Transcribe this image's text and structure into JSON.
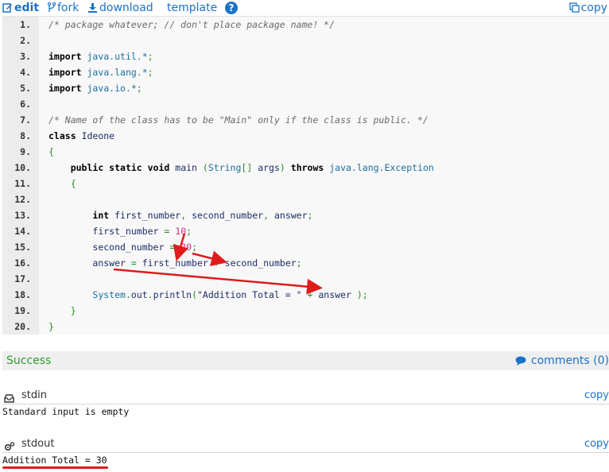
{
  "toolbar": {
    "edit_label": "edit",
    "fork_label": "fork",
    "download_label": "download",
    "template_label": "template",
    "help_icon": "?",
    "copy_label": "copy"
  },
  "code_lines": [
    {
      "n": "1.",
      "tokens": [
        [
          "c-comment",
          "/* package whatever; // don't place package name! */"
        ]
      ]
    },
    {
      "n": "2.",
      "tokens": []
    },
    {
      "n": "3.",
      "tokens": [
        [
          "c-kw",
          "import"
        ],
        [
          "",
          " "
        ],
        [
          "c-pkg",
          "java.util.*"
        ],
        [
          "c-punc",
          ";"
        ]
      ]
    },
    {
      "n": "4.",
      "tokens": [
        [
          "c-kw",
          "import"
        ],
        [
          "",
          " "
        ],
        [
          "c-pkg",
          "java.lang.*"
        ],
        [
          "c-punc",
          ";"
        ]
      ]
    },
    {
      "n": "5.",
      "tokens": [
        [
          "c-kw",
          "import"
        ],
        [
          "",
          " "
        ],
        [
          "c-pkg",
          "java.io.*"
        ],
        [
          "c-punc",
          ";"
        ]
      ]
    },
    {
      "n": "6.",
      "tokens": []
    },
    {
      "n": "7.",
      "tokens": [
        [
          "c-comment",
          "/* Name of the class has to be \"Main\" only if the class is public. */"
        ]
      ]
    },
    {
      "n": "8.",
      "tokens": [
        [
          "c-kw",
          "class"
        ],
        [
          "",
          " "
        ],
        [
          "c-id",
          "Ideone"
        ]
      ]
    },
    {
      "n": "9.",
      "tokens": [
        [
          "c-punc",
          "{"
        ]
      ]
    },
    {
      "n": "10.",
      "tokens": [
        [
          "",
          "    "
        ],
        [
          "c-kw",
          "public static void"
        ],
        [
          "",
          " "
        ],
        [
          "c-id",
          "main"
        ],
        [
          "",
          " "
        ],
        [
          "c-punc",
          "("
        ],
        [
          "c-type",
          "String"
        ],
        [
          "c-punc",
          "[]"
        ],
        [
          "",
          " "
        ],
        [
          "c-id",
          "args"
        ],
        [
          "c-punc",
          ")"
        ],
        [
          "",
          " "
        ],
        [
          "c-kw",
          "throws"
        ],
        [
          "",
          " "
        ],
        [
          "c-pkg",
          "java.lang."
        ],
        [
          "c-type",
          "Exception"
        ]
      ]
    },
    {
      "n": "11.",
      "tokens": [
        [
          "",
          "    "
        ],
        [
          "c-punc",
          "{"
        ]
      ]
    },
    {
      "n": "12.",
      "tokens": []
    },
    {
      "n": "13.",
      "tokens": [
        [
          "",
          "        "
        ],
        [
          "c-kw",
          "int"
        ],
        [
          "",
          " "
        ],
        [
          "c-id",
          "first_number"
        ],
        [
          "c-punc",
          ","
        ],
        [
          "",
          " "
        ],
        [
          "c-id",
          "second_number"
        ],
        [
          "c-punc",
          ","
        ],
        [
          "",
          " "
        ],
        [
          "c-id",
          "answer"
        ],
        [
          "c-punc",
          ";"
        ]
      ]
    },
    {
      "n": "14.",
      "tokens": [
        [
          "",
          "        "
        ],
        [
          "c-id",
          "first_number"
        ],
        [
          "",
          " "
        ],
        [
          "c-punc",
          "="
        ],
        [
          "",
          " "
        ],
        [
          "c-num",
          "10"
        ],
        [
          "c-punc",
          ";"
        ]
      ]
    },
    {
      "n": "15.",
      "tokens": [
        [
          "",
          "        "
        ],
        [
          "c-id",
          "second_number"
        ],
        [
          "",
          " "
        ],
        [
          "c-punc",
          "="
        ],
        [
          "",
          " "
        ],
        [
          "c-num",
          "20"
        ],
        [
          "c-punc",
          ";"
        ]
      ]
    },
    {
      "n": "16.",
      "tokens": [
        [
          "",
          "        "
        ],
        [
          "c-id",
          "answer"
        ],
        [
          "",
          " "
        ],
        [
          "c-punc",
          "="
        ],
        [
          "",
          " "
        ],
        [
          "c-id",
          "first_number"
        ],
        [
          "",
          " "
        ],
        [
          "c-punc",
          "+"
        ],
        [
          "",
          " "
        ],
        [
          "c-id",
          "second_number"
        ],
        [
          "c-punc",
          ";"
        ]
      ]
    },
    {
      "n": "17.",
      "tokens": []
    },
    {
      "n": "18.",
      "tokens": [
        [
          "",
          "        "
        ],
        [
          "c-type",
          "System"
        ],
        [
          "c-punc",
          "."
        ],
        [
          "c-id",
          "out"
        ],
        [
          "c-punc",
          "."
        ],
        [
          "c-id",
          "println"
        ],
        [
          "c-punc",
          "("
        ],
        [
          "c-str",
          "\"Addition Total = \""
        ],
        [
          "",
          " "
        ],
        [
          "c-punc",
          "+"
        ],
        [
          "",
          " "
        ],
        [
          "c-id",
          "answer"
        ],
        [
          "",
          " "
        ],
        [
          "c-punc",
          ");"
        ]
      ]
    },
    {
      "n": "19.",
      "tokens": [
        [
          "",
          "    "
        ],
        [
          "c-punc",
          "}"
        ]
      ]
    },
    {
      "n": "20.",
      "tokens": [
        [
          "c-punc",
          "}"
        ]
      ]
    }
  ],
  "status": {
    "result": "Success",
    "comments_label": "comments (0)"
  },
  "stdin": {
    "title": "stdin",
    "copy_label": "copy",
    "content": "Standard input is empty"
  },
  "stdout": {
    "title": "stdout",
    "copy_label": "copy",
    "content": "Addition Total = 30"
  },
  "colors": {
    "link": "#1a73c8",
    "success": "#2e9d2e",
    "annotation": "#e01b1b"
  }
}
